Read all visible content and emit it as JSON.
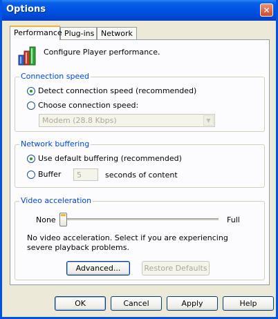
{
  "window": {
    "title": "Options",
    "close_symbol": "✕"
  },
  "tabs": [
    {
      "label": "Performance",
      "active": true
    },
    {
      "label": "Plug-ins",
      "active": false
    },
    {
      "label": "Network",
      "active": false
    }
  ],
  "header": {
    "description": "Configure Player performance."
  },
  "connection_speed": {
    "legend": "Connection speed",
    "detect_label": "Detect connection speed (recommended)",
    "detect_checked": true,
    "choose_label": "Choose connection speed:",
    "choose_checked": false,
    "dropdown_value": "Modem (28.8 Kbps)"
  },
  "network_buffering": {
    "legend": "Network buffering",
    "default_label": "Use default buffering (recommended)",
    "default_checked": true,
    "buffer_label": "Buffer",
    "buffer_value": "5",
    "buffer_suffix": "seconds of content"
  },
  "video_acceleration": {
    "legend": "Video acceleration",
    "min_label": "None",
    "max_label": "Full",
    "level": 0,
    "description": "No video acceleration. Select if you are experiencing severe playback problems.",
    "advanced_button": "Advanced...",
    "restore_button": "Restore Defaults"
  },
  "footer": {
    "ok": "OK",
    "cancel": "Cancel",
    "apply": "Apply",
    "help": "Help"
  },
  "colors": {
    "title_bar": "#0054e3",
    "group_legend": "#0046d5",
    "radio_dot": "#21a121",
    "close_button": "#d0482b"
  }
}
